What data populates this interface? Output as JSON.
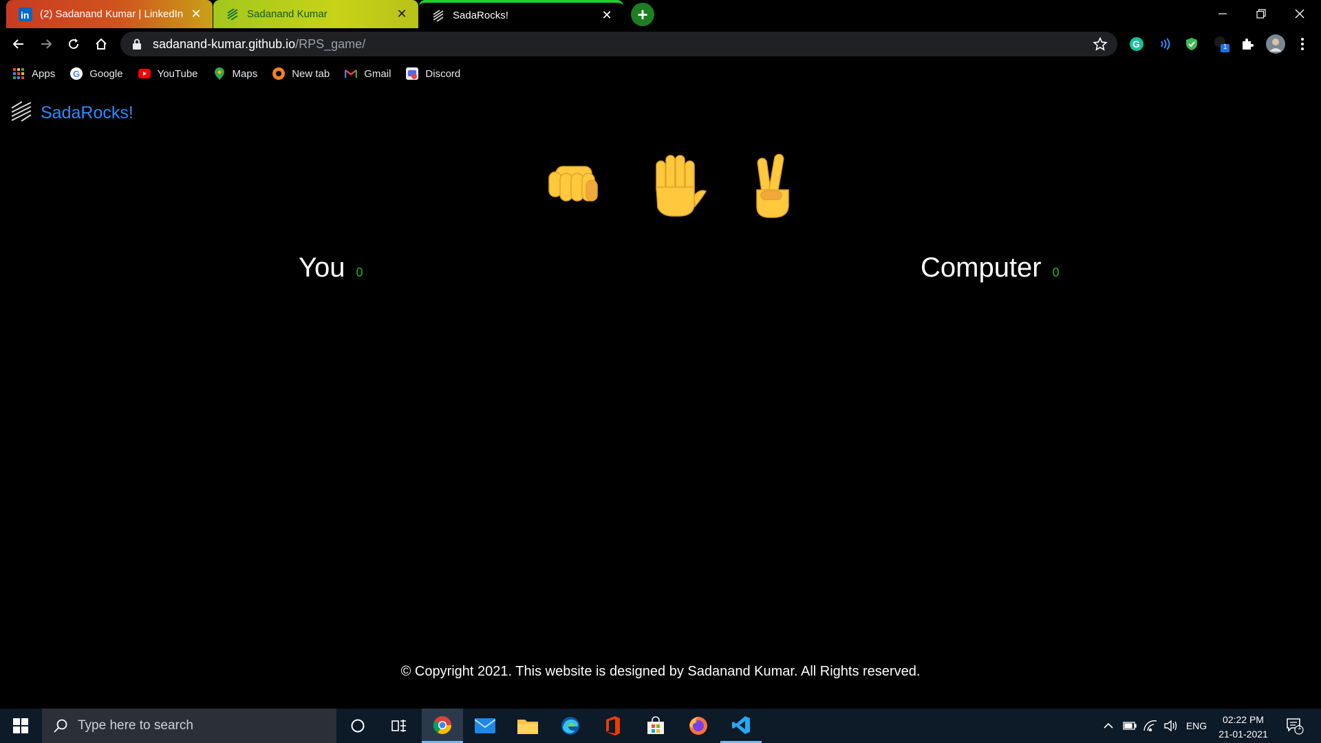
{
  "browser": {
    "tabs": [
      {
        "title": "(2) Sadanand Kumar | LinkedIn",
        "icon": "linkedin-icon",
        "active": false
      },
      {
        "title": "Sadanand Kumar",
        "icon": "sada-logo-icon",
        "active": false
      },
      {
        "title": "SadaRocks!",
        "icon": "sada-logo-icon",
        "active": true
      }
    ],
    "url": {
      "host": "sadanand-kumar.github.io",
      "path": "/RPS_game/"
    },
    "bookmarks": [
      {
        "label": "Apps",
        "icon": "apps-grid-icon"
      },
      {
        "label": "Google",
        "icon": "google-icon"
      },
      {
        "label": "YouTube",
        "icon": "youtube-icon"
      },
      {
        "label": "Maps",
        "icon": "maps-pin-icon"
      },
      {
        "label": "New tab",
        "icon": "newtab-icon"
      },
      {
        "label": "Gmail",
        "icon": "gmail-icon"
      },
      {
        "label": "Discord",
        "icon": "discord-icon"
      }
    ],
    "extension_badge": "1"
  },
  "page": {
    "brand": "SadaRocks!",
    "choices": [
      {
        "name": "rock",
        "icon": "fist-icon"
      },
      {
        "name": "paper",
        "icon": "raised-hand-icon"
      },
      {
        "name": "scissors",
        "icon": "victory-hand-icon"
      }
    ],
    "player": {
      "label": "You",
      "score": "0"
    },
    "computer": {
      "label": "Computer",
      "score": "0"
    },
    "footer": "© Copyright 2021. This website is designed by Sadanand Kumar. All Rights reserved."
  },
  "taskbar": {
    "search_placeholder": "Type here to search",
    "language": "ENG",
    "time": "02:22 PM",
    "date": "21-01-2021",
    "notification_count": "1"
  },
  "colors": {
    "brand_blue": "#2a8cff",
    "score_green": "#1fb81f",
    "emoji_yellow": "#ffc83d"
  }
}
